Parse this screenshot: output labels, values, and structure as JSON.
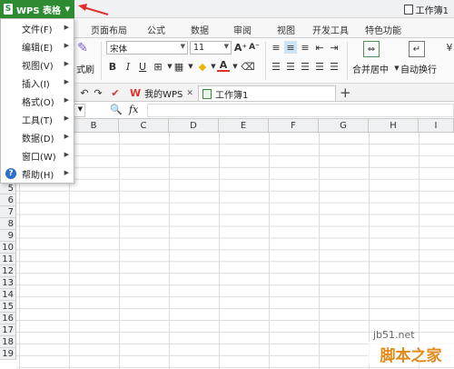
{
  "app": {
    "button_label": "WPS 表格",
    "s_glyph": "S",
    "doc_title": "工作簿1"
  },
  "ribbon_tabs": [
    "页面布局",
    "公式",
    "数据",
    "审阅",
    "视图",
    "开发工具",
    "特色功能"
  ],
  "toolbar": {
    "font_name": "宋体",
    "font_size": "11",
    "format_painter_label": "式刷",
    "merge_center_label": "合并居中",
    "wrap_text_label": "自动换行",
    "bold": "B",
    "italic": "I",
    "underline": "U",
    "grow_font": "A⁺",
    "shrink_font": "A⁻"
  },
  "doc_tabs": [
    {
      "label": "我的WPS",
      "active": false
    },
    {
      "label": "工作簿1",
      "active": true
    }
  ],
  "formula_bar": {
    "fx_label": "fx",
    "zoom_glyph": "🔍"
  },
  "columns": [
    "B",
    "C",
    "D",
    "E",
    "F",
    "G",
    "H",
    "I"
  ],
  "rows": [
    "5",
    "6",
    "7",
    "8",
    "9",
    "10",
    "11",
    "12",
    "13",
    "14",
    "15",
    "16",
    "17",
    "18",
    "19"
  ],
  "menu": {
    "items": [
      {
        "label": "文件(F)"
      },
      {
        "label": "编辑(E)"
      },
      {
        "label": "视图(V)"
      },
      {
        "label": "插入(I)"
      },
      {
        "label": "格式(O)"
      },
      {
        "label": "工具(T)"
      },
      {
        "label": "数据(D)"
      },
      {
        "label": "窗口(W)"
      },
      {
        "label": "帮助(H)"
      }
    ]
  },
  "watermark": {
    "url": "jb51.net",
    "logo": "脚本之家"
  },
  "colors": {
    "wps_green": "#2e8b32",
    "arrow_red": "#e0322b",
    "help_blue": "#2d6fc9"
  }
}
